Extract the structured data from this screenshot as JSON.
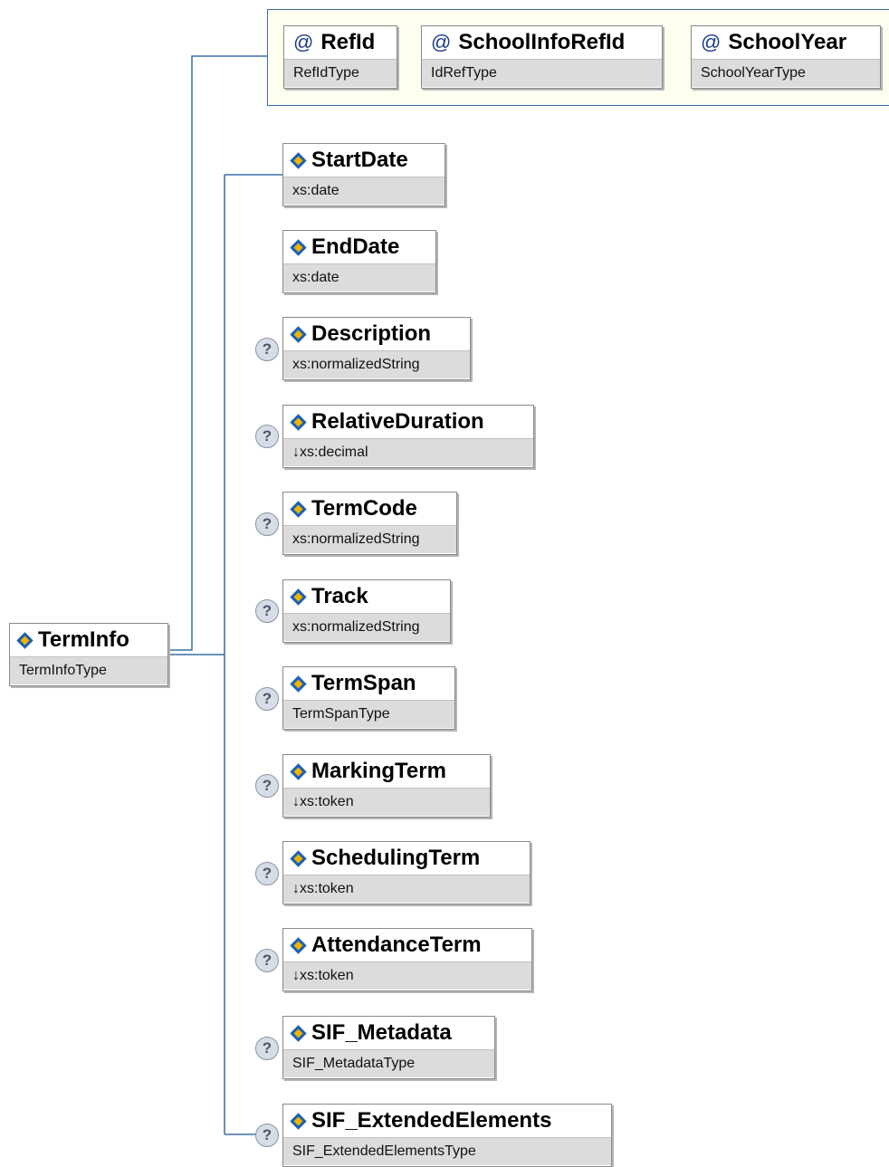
{
  "root": {
    "name": "TermInfo",
    "type": "TermInfoType"
  },
  "attributes": [
    {
      "name": "RefId",
      "type": "RefIdType"
    },
    {
      "name": "SchoolInfoRefId",
      "type": "IdRefType"
    },
    {
      "name": "SchoolYear",
      "type": "SchoolYearType"
    }
  ],
  "elements": [
    {
      "name": "StartDate",
      "type": "xs:date",
      "optional": false
    },
    {
      "name": "EndDate",
      "type": "xs:date",
      "optional": false
    },
    {
      "name": "Description",
      "type": "xs:normalizedString",
      "optional": true
    },
    {
      "name": "RelativeDuration",
      "type": "↓xs:decimal",
      "optional": true
    },
    {
      "name": "TermCode",
      "type": "xs:normalizedString",
      "optional": true
    },
    {
      "name": "Track",
      "type": "xs:normalizedString",
      "optional": true
    },
    {
      "name": "TermSpan",
      "type": "TermSpanType",
      "optional": true
    },
    {
      "name": "MarkingTerm",
      "type": "↓xs:token",
      "optional": true
    },
    {
      "name": "SchedulingTerm",
      "type": "↓xs:token",
      "optional": true
    },
    {
      "name": "AttendanceTerm",
      "type": "↓xs:token",
      "optional": true
    },
    {
      "name": "SIF_Metadata",
      "type": "SIF_MetadataType",
      "optional": true
    },
    {
      "name": "SIF_ExtendedElements",
      "type": "SIF_ExtendedElementsType",
      "optional": true
    }
  ],
  "icons": {
    "element": "element-icon",
    "attribute": "attribute-at-icon",
    "optional": "optional-question-icon"
  },
  "colors": {
    "connector": "#3a6ea5",
    "type_bar": "#dcdcdc",
    "attr_group_bg": "#fffff0"
  }
}
